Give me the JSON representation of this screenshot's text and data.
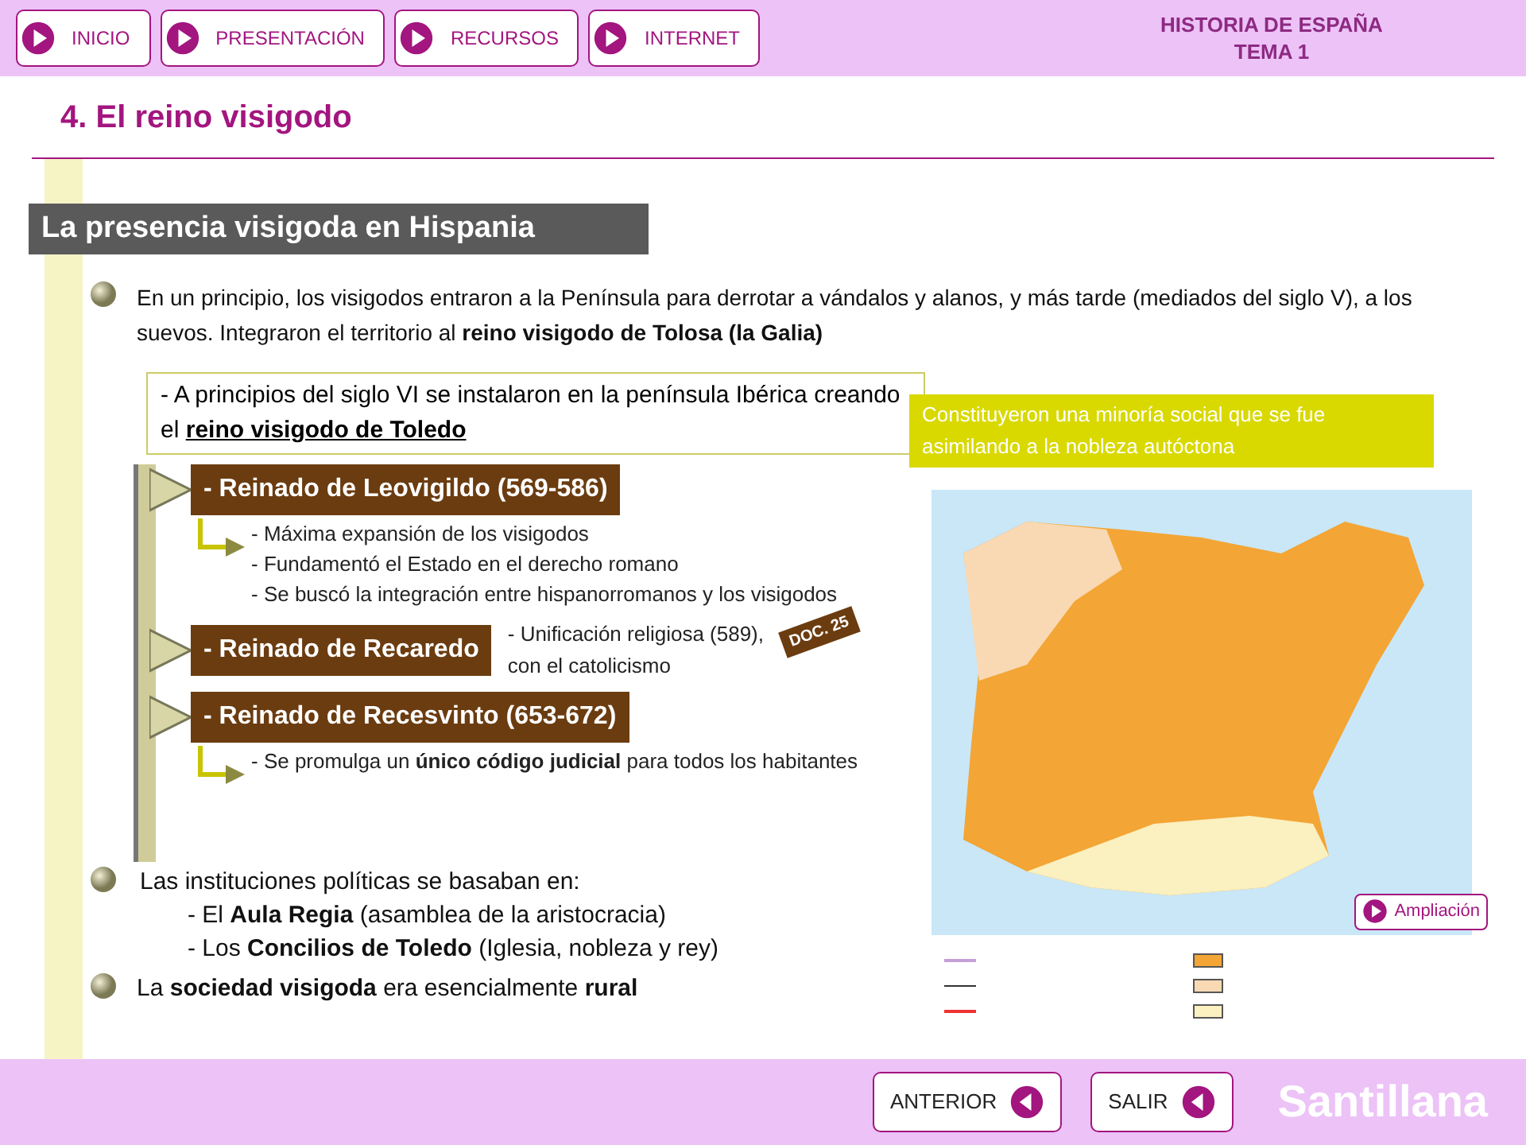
{
  "nav": [
    {
      "label": "INICIO"
    },
    {
      "label": "PRESENTACIÓN"
    },
    {
      "label": "RECURSOS"
    },
    {
      "label": "INTERNET"
    }
  ],
  "course": {
    "line1": "HISTORIA DE ESPAÑA",
    "line2": "TEMA 1"
  },
  "title": "4. El reino visigodo",
  "section_heading": "La presencia visigoda en Hispania",
  "intro": "En un principio, los visigodos entraron a la Península para derrotar a vándalos y alanos, y más tarde (mediados del siglo V), a los suevos. Integraron el territorio al **reino visigodo de Tolosa (la Galia)**",
  "callout": {
    "text": "- A principios del siglo VI se instalaron en la península Ibérica creando el",
    "emphasis": "reino visigodo de Toledo"
  },
  "note": "Constituyeron una minoría social que se fue asimilando a la nobleza autóctona",
  "reigns": [
    {
      "heading": "- Reinado de Leovigildo (569-586)",
      "details": [
        "- Máxima expansión de los visigodos",
        "- Fundamentó el Estado en el derecho romano",
        "- Se buscó la integración entre hispanorromanos y los visigodos"
      ]
    },
    {
      "heading": "- Reinado de Recaredo",
      "aside": "- Unificación religiosa (589), con el catolicismo"
    },
    {
      "heading": "- Reinado de Recesvinto (653-672)",
      "details": [
        "- Se promulga un **único código judicial** para todos los habitantes"
      ]
    }
  ],
  "doc_tag": "DOC. 25",
  "institutions": {
    "text": "Las instituciones políticas se basaban en:",
    "items": [
      "- El **Aula Regia** (asamblea de la aristocracia)",
      "- Los **Concilios de Toledo** (Iglesia, nobleza y rey)"
    ]
  },
  "society": "La **sociedad visigoda** era esencialmente **rural**",
  "ampliacion": "Ampliación",
  "footer": {
    "buttons": [
      "ANTERIOR",
      "SALIR"
    ],
    "brand": "Santillana"
  }
}
